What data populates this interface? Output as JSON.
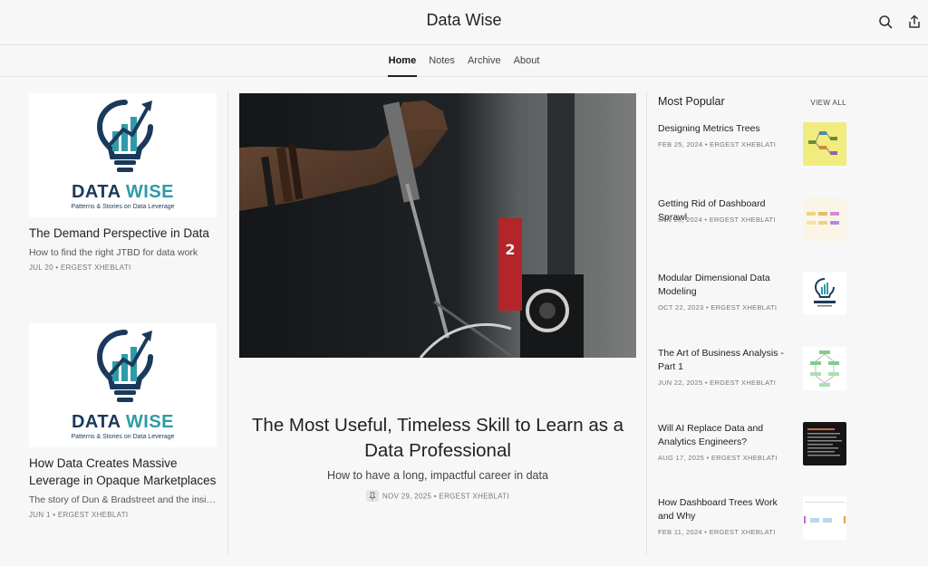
{
  "header": {
    "title": "Data Wise",
    "search_icon": "search-icon",
    "share_icon": "share-icon"
  },
  "nav": {
    "tabs": [
      {
        "label": "Home",
        "active": true
      },
      {
        "label": "Notes"
      },
      {
        "label": "Archive"
      },
      {
        "label": "About"
      }
    ]
  },
  "logo": {
    "title_part1": "DATA",
    "title_part2": "WISE",
    "tagline": "Patterns & Stories on Data Leverage"
  },
  "left_posts": [
    {
      "title": "The Demand Perspective in Data",
      "subtitle": "How to find the right JTBD for data work",
      "meta": "JUL 20 • ERGEST XHEBLATI"
    },
    {
      "title": "How Data Creates Massive Leverage in Opaque Marketplaces",
      "subtitle": "The story of Dun & Bradstreet and the insig…",
      "meta": "JUN 1 • ERGEST XHEBLATI"
    }
  ],
  "featured": {
    "title": "The Most Useful, Timeless Skill to Learn as a Data Professional",
    "subtitle": "How to have a long, impactful career in data",
    "meta": "NOV 29, 2025 • ERGEST XHEBLATI",
    "image_label": "2"
  },
  "popular": {
    "heading": "Most Popular",
    "view_all": "VIEW ALL",
    "items": [
      {
        "title": "Designing Metrics Trees",
        "meta": "FEB 25, 2024 • ERGEST XHEBLATI",
        "thumb": "yellow-diagram"
      },
      {
        "title": "Getting Rid of Dashboard Sprawl",
        "meta": "JAN 28, 2024 • ERGEST XHEBLATI",
        "thumb": "pastel-diagram"
      },
      {
        "title": "Modular Dimensional Data Modeling",
        "meta": "OCT 22, 2023 • ERGEST XHEBLATI",
        "thumb": "datawise-logo"
      },
      {
        "title": "The Art of Business Analysis - Part 1",
        "meta": "JUN 22, 2025 • ERGEST XHEBLATI",
        "thumb": "green-tree"
      },
      {
        "title": "Will AI Replace Data and Analytics Engineers?",
        "meta": "AUG 17, 2025 • ERGEST XHEBLATI",
        "thumb": "dark-text"
      },
      {
        "title": "How Dashboard Trees Work and Why",
        "meta": "FEB 11, 2024 • ERGEST XHEBLATI",
        "thumb": "dashboard-tree"
      }
    ]
  },
  "colors": {
    "brand_navy": "#1b3a5b",
    "brand_teal": "#2f9ba8",
    "background": "#f7f7f7"
  }
}
